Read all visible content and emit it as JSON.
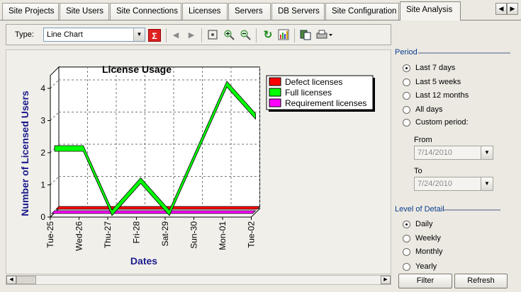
{
  "tabs": [
    {
      "label": "Site Projects"
    },
    {
      "label": "Site Users"
    },
    {
      "label": "Site Connections"
    },
    {
      "label": "Licenses"
    },
    {
      "label": "Servers"
    },
    {
      "label": "DB Servers"
    },
    {
      "label": "Site Configuration"
    },
    {
      "label": "Site Analysis",
      "active": true
    }
  ],
  "toolbar": {
    "type_label": "Type:",
    "type_value": "Line Chart",
    "icons": [
      "sigma-icon",
      "prev-arrow-icon",
      "next-arrow-icon",
      "fit-icon",
      "zoom-in-icon",
      "zoom-out-icon",
      "refresh-icon",
      "chart-settings-icon",
      "copy-icon",
      "print-icon"
    ]
  },
  "chart_data": {
    "type": "line",
    "title": "License Usage",
    "xlabel": "Dates",
    "ylabel": "Number of Licensed Users",
    "categories": [
      "Tue-25",
      "Wed-26",
      "Thu-27",
      "Fri-28",
      "Sat-29",
      "Sun-30",
      "Mon-01",
      "Tue-02"
    ],
    "yticks": [
      "0",
      "1",
      "2",
      "3",
      "4"
    ],
    "ylim": [
      0,
      4.4
    ],
    "grid": true,
    "legend": "top-right",
    "series": [
      {
        "name": "Defect licenses",
        "color": "#ff0000",
        "values": [
          0,
          0,
          0,
          0,
          0,
          0,
          0,
          0
        ]
      },
      {
        "name": "Full licenses",
        "color": "#00ff00",
        "values": [
          2,
          2,
          0,
          1,
          0,
          2,
          4,
          3
        ]
      },
      {
        "name": "Requirement licenses",
        "color": "#ff00ff",
        "values": [
          0,
          0,
          0,
          0,
          0,
          0,
          0,
          0
        ]
      }
    ]
  },
  "period": {
    "label": "Period",
    "options": [
      {
        "label": "Last 7 days",
        "selected": true
      },
      {
        "label": "Last 5 weeks",
        "selected": false
      },
      {
        "label": "Last 12 months",
        "selected": false
      },
      {
        "label": "All days",
        "selected": false
      },
      {
        "label": "Custom period:",
        "selected": false
      }
    ],
    "from_label": "From",
    "from_value": "7/14/2010",
    "to_label": "To",
    "to_value": "7/24/2010"
  },
  "detail": {
    "label": "Level of Detail",
    "options": [
      {
        "label": "Daily",
        "selected": true
      },
      {
        "label": "Weekly",
        "selected": false
      },
      {
        "label": "Monthly",
        "selected": false
      },
      {
        "label": "Yearly",
        "selected": false
      }
    ]
  },
  "buttons": {
    "filter": "Filter",
    "refresh": "Refresh"
  },
  "colors": {
    "accent": "#0a3d8f",
    "axis_title": "#1a1a8c"
  }
}
